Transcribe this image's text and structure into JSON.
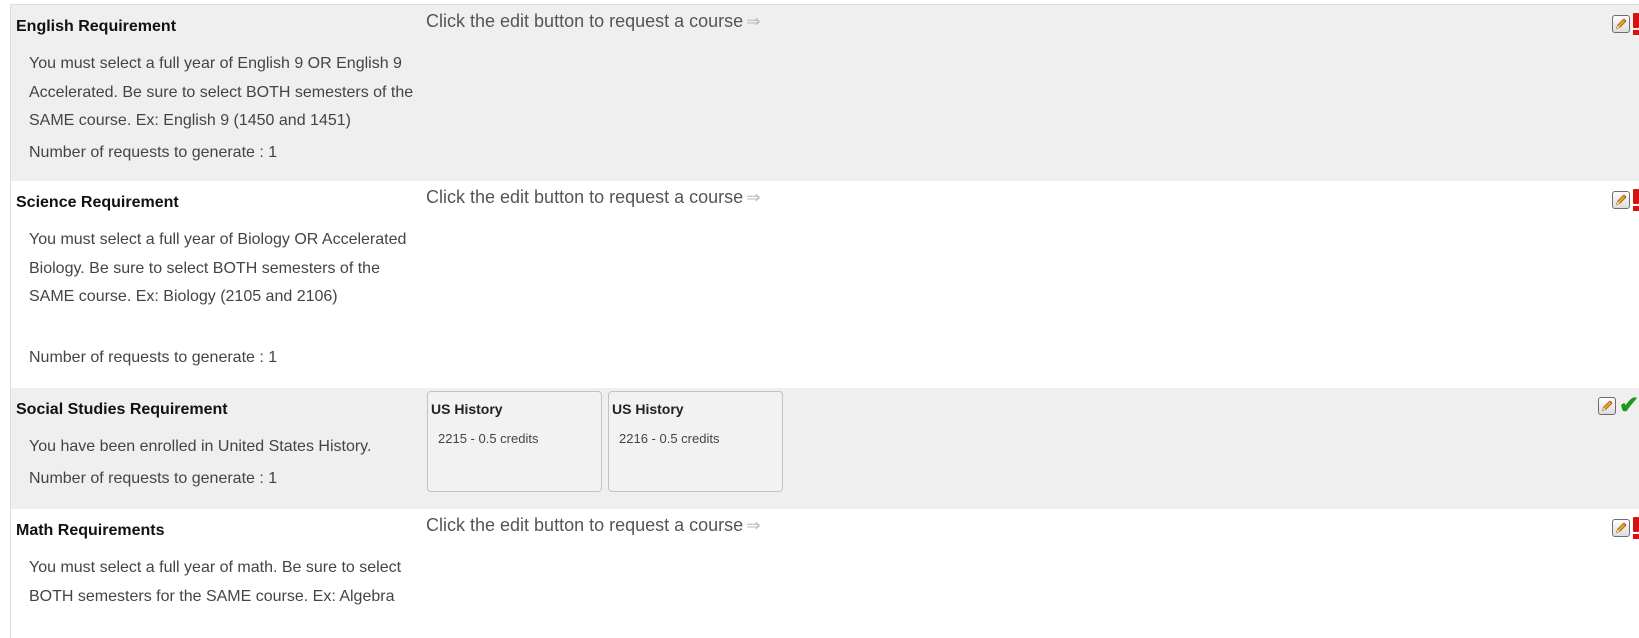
{
  "edit_prompt": "Click the edit button to request a course",
  "requirements": [
    {
      "title": "English Requirement",
      "description": "You must select a full year of English 9 OR English 9 Accelerated. Be sure to select BOTH semesters of the SAME course. Ex: English 9 (1450 and 1451)",
      "requests": "Number of requests to generate : 1",
      "status": "incomplete"
    },
    {
      "title": "Science Requirement",
      "description": "You must select a full year of Biology OR Accelerated Biology. Be sure to select BOTH semesters of the SAME course. Ex: Biology (2105 and 2106)",
      "requests": "Number of requests to generate : 1",
      "status": "incomplete"
    },
    {
      "title": "Social Studies Requirement",
      "description": "You have been enrolled in United States History.",
      "requests": "Number of requests to generate : 1",
      "status": "complete",
      "courses": [
        {
          "name": "US History",
          "credits": "2215 - 0.5 credits"
        },
        {
          "name": "US History",
          "credits": "2216 - 0.5 credits"
        }
      ]
    },
    {
      "title": "Math Requirements",
      "description": "You must select a full year of math. Be sure to select BOTH semesters for the SAME course. Ex: Algebra",
      "status": "incomplete"
    }
  ],
  "icons": {
    "edit": "edit-pencil-icon",
    "incomplete": "exclamation-icon",
    "complete": "checkmark-icon"
  },
  "colors": {
    "shaded_row": "#efefef",
    "warning": "#d81010",
    "success": "#1d9a1d"
  }
}
